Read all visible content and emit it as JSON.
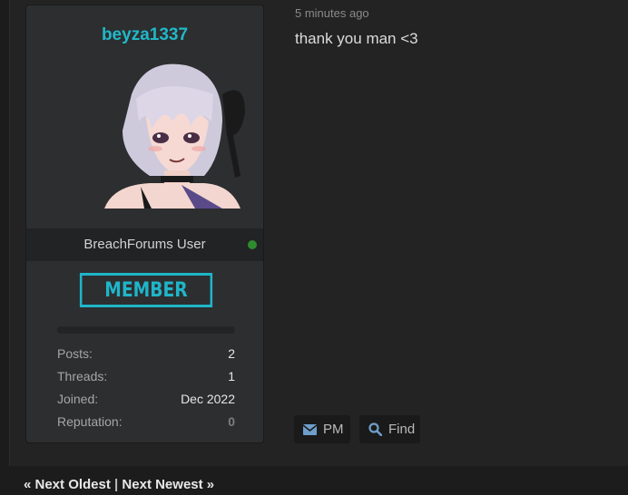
{
  "author": {
    "username": "beyza1337",
    "usertitle": "BreachForums User",
    "online_status": "online",
    "online_color": "#2e8b2e",
    "rank_badge": "MEMBER",
    "username_color": "#21b8c9",
    "stats": [
      {
        "label": "Posts:",
        "value": "2"
      },
      {
        "label": "Threads:",
        "value": "1"
      },
      {
        "label": "Joined:",
        "value": "Dec 2022"
      },
      {
        "label": "Reputation:",
        "value": "0"
      }
    ]
  },
  "post": {
    "timestamp": "5 minutes ago",
    "message": "thank you man <3"
  },
  "actions": {
    "pm_label": "PM",
    "pm_icon": "envelope-icon",
    "find_label": "Find",
    "find_icon": "search-icon"
  },
  "thread_nav": {
    "prev_label": "« Next Oldest",
    "separator": "|",
    "next_label": "Next Newest »"
  }
}
